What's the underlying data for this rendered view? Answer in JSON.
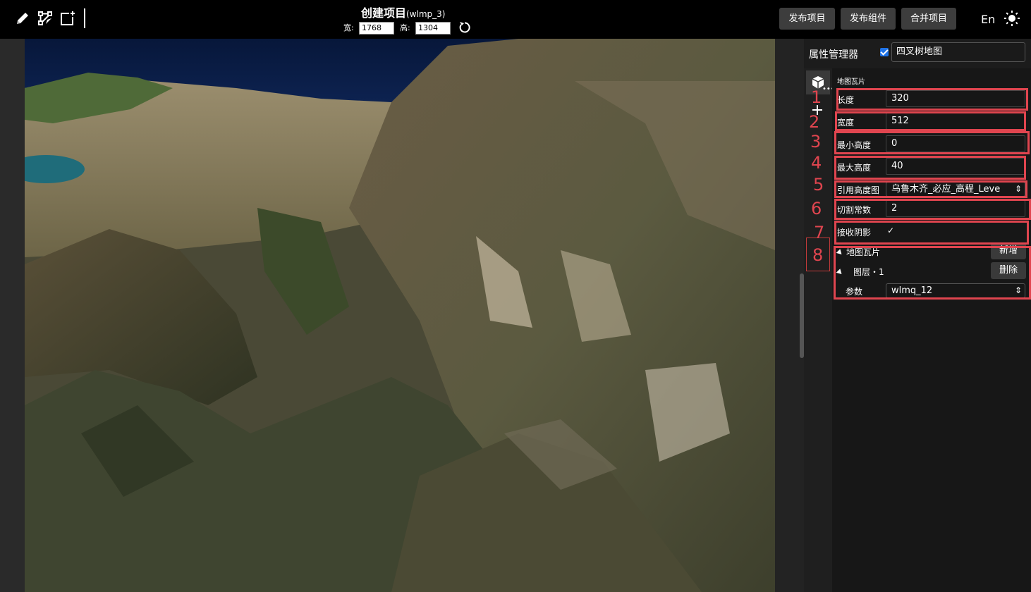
{
  "toolbar": {
    "icons": [
      "pencil-icon",
      "node-edit-icon",
      "add-frame-icon"
    ]
  },
  "header": {
    "title": "创建项目",
    "project_id": "(wlmp_3)",
    "width_label": "宽:",
    "width_value": "1768",
    "height_label": "高:",
    "height_value": "1304",
    "buttons": {
      "publish_project": "发布项目",
      "publish_component": "发布组件",
      "merge_project": "合并项目"
    },
    "lang": "En"
  },
  "panel": {
    "title": "属性管理器",
    "enabled": true,
    "map_name": "四叉树地图",
    "section_title": "地图瓦片",
    "fields": {
      "length_label": "长度",
      "length_value": "320",
      "width_label": "宽度",
      "width_value": "512",
      "min_height_label": "最小高度",
      "min_height_value": "0",
      "max_height_label": "最大高度",
      "max_height_value": "40",
      "heightmap_label": "引用高度图",
      "heightmap_value": "乌鲁木齐_必应_高程_Leve",
      "split_label": "切割常数",
      "split_value": "2",
      "shadow_label": "接收阴影",
      "shadow_checked": true
    },
    "tree": {
      "tiles_label": "地图瓦片",
      "add_button": "新增",
      "layer_label": "图层・1",
      "delete_button": "删除",
      "param_label": "参数",
      "param_value": "wlmq_12"
    }
  },
  "annotations": [
    "1",
    "2",
    "3",
    "4",
    "5",
    "6",
    "7",
    "8"
  ],
  "colors": {
    "annotation": "#e0454f",
    "accent": "#1e73e8",
    "button": "#3d3d3d"
  }
}
